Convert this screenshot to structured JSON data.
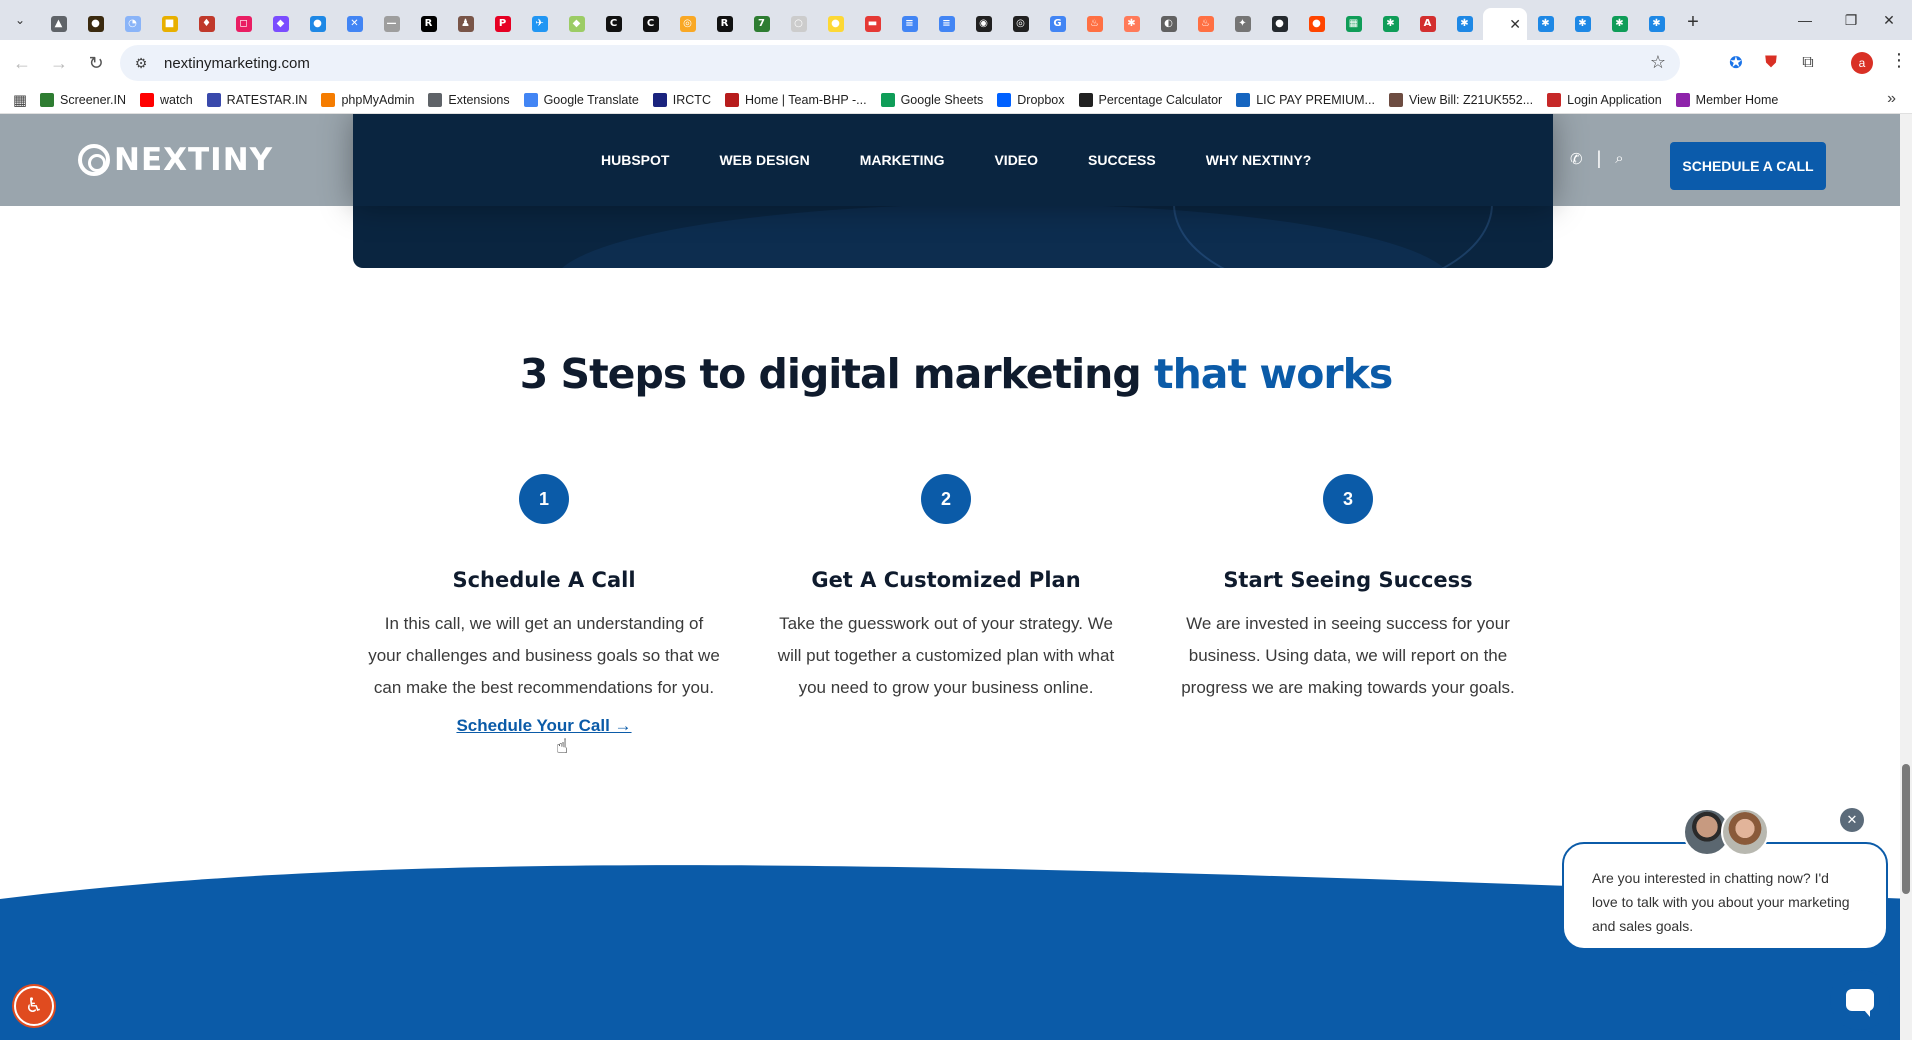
{
  "browser": {
    "url": "nextinymarketing.com",
    "tabs": [
      {
        "icon": "tab-favicon",
        "color": "#5f6368",
        "glyph": "▲"
      },
      {
        "icon": "tab-favicon",
        "color": "#3b2a0f",
        "glyph": "●"
      },
      {
        "icon": "tab-favicon",
        "color": "#8ab4f8",
        "glyph": "◔"
      },
      {
        "icon": "tab-favicon",
        "color": "#e8b000",
        "glyph": "■"
      },
      {
        "icon": "tab-favicon",
        "color": "#c0392b",
        "glyph": "♦"
      },
      {
        "icon": "tab-favicon",
        "color": "#e91e63",
        "glyph": "◻"
      },
      {
        "icon": "tab-favicon",
        "color": "#7b4dff",
        "glyph": "◆"
      },
      {
        "icon": "tab-favicon",
        "color": "#1e88e5",
        "glyph": "●"
      },
      {
        "icon": "tab-favicon",
        "color": "#4285f4",
        "glyph": "✕"
      },
      {
        "icon": "tab-favicon",
        "color": "#9e9e9e",
        "glyph": "—"
      },
      {
        "icon": "tab-favicon",
        "color": "#000000",
        "glyph": "R"
      },
      {
        "icon": "tab-favicon",
        "color": "#795548",
        "glyph": "♟"
      },
      {
        "icon": "tab-favicon",
        "color": "#e60023",
        "glyph": "P"
      },
      {
        "icon": "tab-favicon",
        "color": "#2196f3",
        "glyph": "✈"
      },
      {
        "icon": "tab-favicon",
        "color": "#9ccc65",
        "glyph": "◆"
      },
      {
        "icon": "tab-favicon",
        "color": "#111111",
        "glyph": "C"
      },
      {
        "icon": "tab-favicon",
        "color": "#111111",
        "glyph": "C"
      },
      {
        "icon": "tab-favicon",
        "color": "#f9a825",
        "glyph": "◎"
      },
      {
        "icon": "tab-favicon",
        "color": "#111111",
        "glyph": "R"
      },
      {
        "icon": "tab-favicon",
        "color": "#2e7d32",
        "glyph": "7"
      },
      {
        "icon": "tab-favicon",
        "color": "#cccccc",
        "glyph": "○"
      },
      {
        "icon": "tab-favicon",
        "color": "#fdd835",
        "glyph": "●"
      },
      {
        "icon": "tab-favicon",
        "color": "#e53935",
        "glyph": "▬"
      },
      {
        "icon": "tab-favicon",
        "color": "#4285f4",
        "glyph": "≡"
      },
      {
        "icon": "tab-favicon",
        "color": "#4285f4",
        "glyph": "≡"
      },
      {
        "icon": "tab-favicon",
        "color": "#212121",
        "glyph": "◉"
      },
      {
        "icon": "tab-favicon",
        "color": "#212121",
        "glyph": "◎"
      },
      {
        "icon": "tab-favicon",
        "color": "#4285f4",
        "glyph": "G"
      },
      {
        "icon": "tab-favicon",
        "color": "#ff7043",
        "glyph": "♨"
      },
      {
        "icon": "tab-favicon",
        "color": "#ff7a59",
        "glyph": "✱"
      },
      {
        "icon": "tab-favicon",
        "color": "#616161",
        "glyph": "◐"
      },
      {
        "icon": "tab-favicon",
        "color": "#ff7043",
        "glyph": "♨"
      },
      {
        "icon": "tab-favicon",
        "color": "#757575",
        "glyph": "✦"
      },
      {
        "icon": "tab-favicon",
        "color": "#24292e",
        "glyph": "●"
      },
      {
        "icon": "tab-favicon",
        "color": "#ff4500",
        "glyph": "●"
      },
      {
        "icon": "tab-favicon",
        "color": "#0f9d58",
        "glyph": "▦"
      },
      {
        "icon": "tab-favicon",
        "color": "#0f9d58",
        "glyph": "✱"
      },
      {
        "icon": "tab-favicon",
        "color": "#d32f2f",
        "glyph": "A"
      },
      {
        "icon": "tab-favicon",
        "color": "#1e88e5",
        "glyph": "✱"
      }
    ],
    "trailing_tabs": [
      {
        "color": "#1e88e5",
        "glyph": "✱"
      },
      {
        "color": "#1e88e5",
        "glyph": "✱"
      },
      {
        "color": "#0f9d58",
        "glyph": "✱"
      },
      {
        "color": "#1e88e5",
        "glyph": "✱"
      }
    ],
    "bookmarks": [
      {
        "label": "Screener.IN",
        "color": "#2e7d32"
      },
      {
        "label": "watch",
        "color": "#ff0000"
      },
      {
        "label": "RATESTAR.IN",
        "color": "#3949ab"
      },
      {
        "label": "phpMyAdmin",
        "color": "#f57c00"
      },
      {
        "label": "Extensions",
        "color": "#5f6368"
      },
      {
        "label": "Google Translate",
        "color": "#4285f4"
      },
      {
        "label": "IRCTC",
        "color": "#1a237e"
      },
      {
        "label": "Home | Team-BHP -...",
        "color": "#b71c1c"
      },
      {
        "label": "Google Sheets",
        "color": "#0f9d58"
      },
      {
        "label": "Dropbox",
        "color": "#0061ff"
      },
      {
        "label": "Percentage Calculator",
        "color": "#212121"
      },
      {
        "label": "LIC PAY PREMIUM...",
        "color": "#1565c0"
      },
      {
        "label": "View Bill: Z21UK552...",
        "color": "#6d4c41"
      },
      {
        "label": "Login Application",
        "color": "#c62828"
      },
      {
        "label": "Member Home",
        "color": "#8e24aa"
      }
    ],
    "profile_initial": "a"
  },
  "site": {
    "logo_text": "NEXTINY",
    "menu": [
      "HUBSPOT",
      "WEB DESIGN",
      "MARKETING",
      "VIDEO",
      "SUCCESS",
      "WHY NEXTINY?"
    ],
    "cta_label": "SCHEDULE A CALL",
    "section_title_main": "3 Steps to digital marketing",
    "section_title_accent": "that works",
    "steps": [
      {
        "number": "1",
        "title": "Schedule A Call",
        "text": "In this call, we will get an understanding of your challenges and business goals so that we can make the best recommendations for you.",
        "link": "Schedule Your Call →"
      },
      {
        "number": "2",
        "title": "Get A Customized Plan",
        "text": "Take the guesswork out of your strategy. We will put together a customized plan with what you need to grow your business online."
      },
      {
        "number": "3",
        "title": "Start Seeing Success",
        "text": "We are invested in seeing success for your business. Using data, we will report on the progress we are making towards your goals."
      }
    ],
    "chat_message": "Are you interested in chatting now? I'd love to talk with you about your marketing and sales goals."
  },
  "colors": {
    "brand_blue": "#0b5ba8",
    "navy": "#0a2540"
  }
}
